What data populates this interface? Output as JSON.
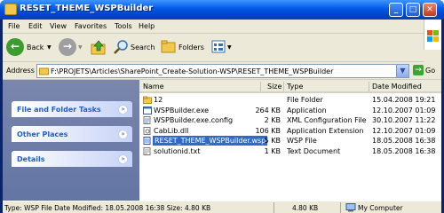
{
  "window": {
    "title": "RESET_THEME_WSPBuilder"
  },
  "menu": [
    "File",
    "Edit",
    "View",
    "Favorites",
    "Tools",
    "Help"
  ],
  "toolbar": {
    "back": "Back",
    "search": "Search",
    "folders": "Folders"
  },
  "address": {
    "label": "Address",
    "path": "F:\\PROJETS\\Articles\\SharePoint_Create-Solution-WSP\\RESET_THEME_WSPBuilder",
    "go": "Go"
  },
  "taskpane": {
    "panels": [
      "File and Folder Tasks",
      "Other Places",
      "Details"
    ]
  },
  "columns": {
    "name": "Name",
    "size": "Size",
    "type": "Type",
    "date": "Date Modified"
  },
  "files": [
    {
      "name": "12",
      "size": "",
      "type": "File Folder",
      "date": "15.04.2008 19:21",
      "icon": "folder-icon"
    },
    {
      "name": "WSPBuilder.exe",
      "size": "264 KB",
      "type": "Application",
      "date": "12.10.2007 01:09",
      "icon": "exe-icon"
    },
    {
      "name": "WSPBuilder.exe.config",
      "size": "2 KB",
      "type": "XML Configuration File",
      "date": "30.10.2007 11:22",
      "icon": "config-icon"
    },
    {
      "name": "CabLib.dll",
      "size": "106 KB",
      "type": "Application Extension",
      "date": "12.10.2007 01:09",
      "icon": "dll-icon"
    },
    {
      "name": "RESET_THEME_WSPBuilder.wsp",
      "size": "5 KB",
      "type": "WSP File",
      "date": "18.05.2008 16:38",
      "icon": "wsp-icon",
      "selected": true
    },
    {
      "name": "solutionid.txt",
      "size": "1 KB",
      "type": "Text Document",
      "date": "18.05.2008 16:38",
      "icon": "text-file-icon"
    }
  ],
  "status": {
    "info": "Type: WSP File Date Modified: 18.05.2008 16:38 Size: 4.80 KB",
    "size": "4.80 KB",
    "location": "My Computer"
  },
  "colors": {
    "titlebar": "#0058e6",
    "taskpane": "#6375a4",
    "selection": "#316ac5"
  }
}
